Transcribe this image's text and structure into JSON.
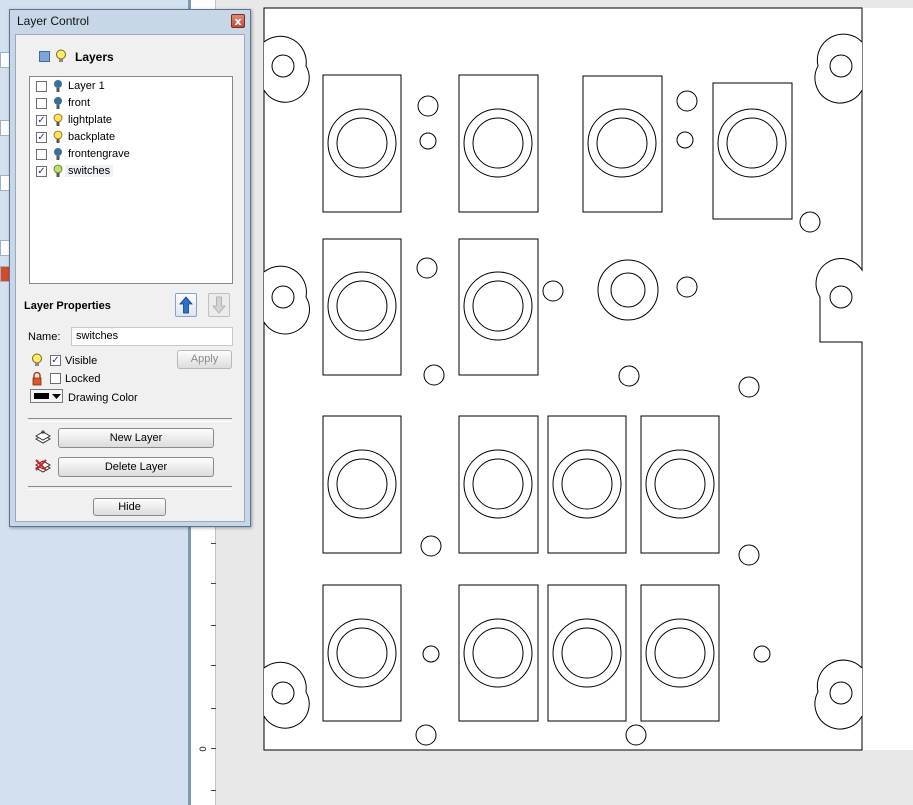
{
  "dialog": {
    "title": "Layer Control",
    "layers_header": "Layers",
    "layers": [
      {
        "name": "Layer 1",
        "checked": false,
        "bulb": "blue"
      },
      {
        "name": "front",
        "checked": false,
        "bulb": "blue"
      },
      {
        "name": "lightplate",
        "checked": true,
        "bulb": "yellow"
      },
      {
        "name": "backplate",
        "checked": true,
        "bulb": "yellow"
      },
      {
        "name": "frontengrave",
        "checked": false,
        "bulb": "blue"
      },
      {
        "name": "switches",
        "checked": true,
        "bulb": "green"
      }
    ],
    "properties_header": "Layer Properties",
    "name_label": "Name:",
    "name_value": "switches",
    "visible_label": "Visible",
    "visible_checked": true,
    "locked_label": "Locked",
    "locked_checked": false,
    "apply_label": "Apply",
    "drawing_color_label": "Drawing Color",
    "new_layer_label": "New Layer",
    "delete_layer_label": "Delete Layer",
    "hide_label": "Hide",
    "close_glyph": "x",
    "check_glyph": "✓"
  },
  "ruler": {
    "zero_label": "0"
  },
  "colors": {
    "drawing_color": "#000000",
    "dialog_frame": "#c8d7e8",
    "sidebar": "#d3e0ee"
  }
}
